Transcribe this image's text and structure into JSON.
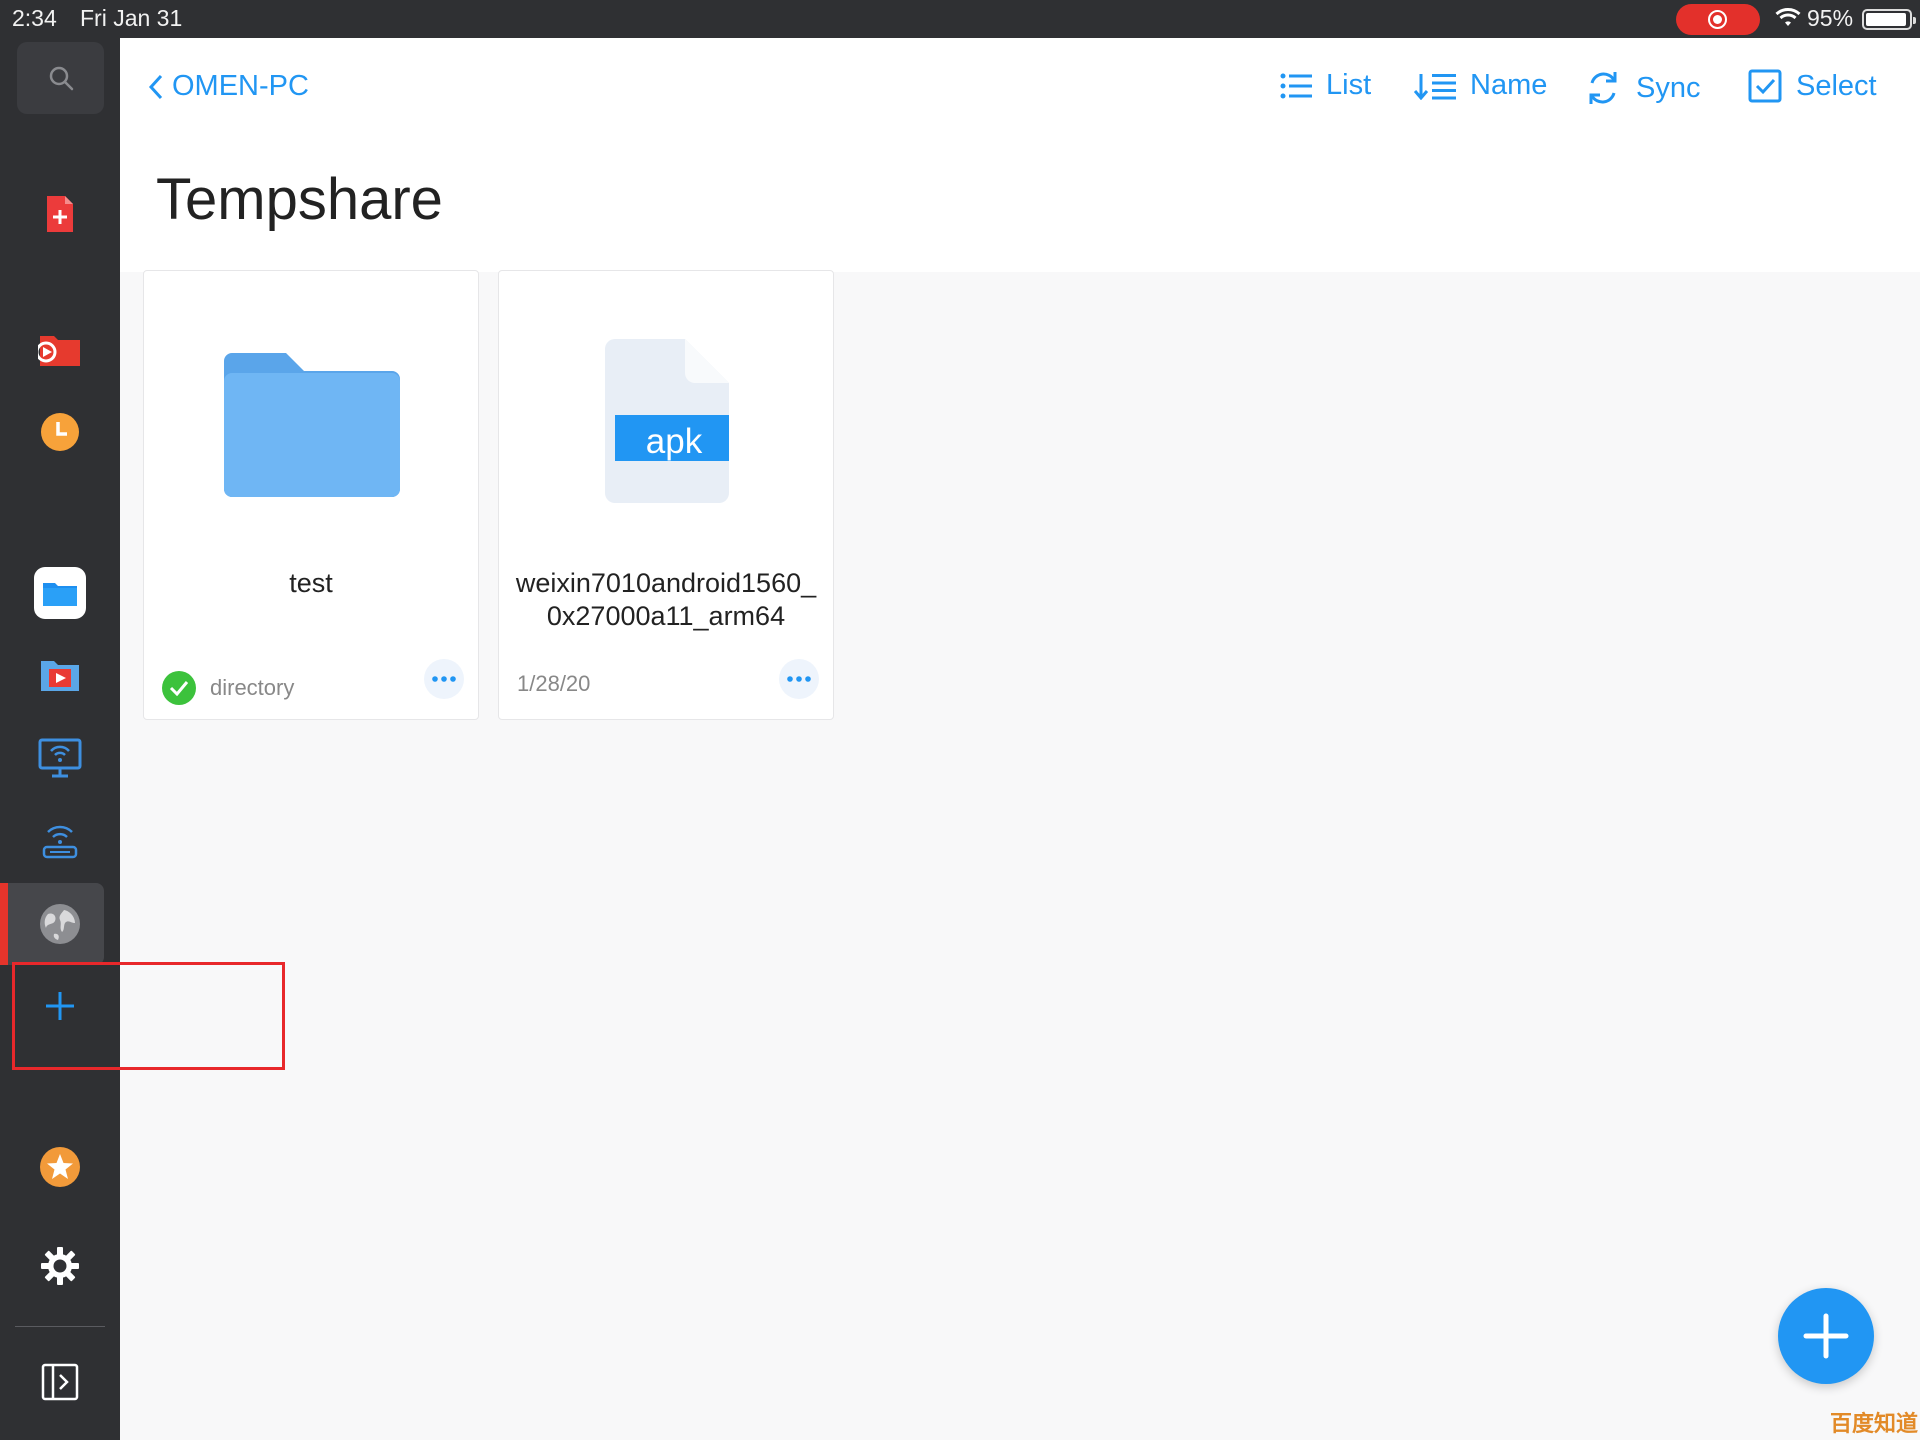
{
  "status_bar": {
    "time": "2:34",
    "date": "Fri Jan 31",
    "battery": "95%",
    "battery_level": 0.95
  },
  "nav": {
    "back_label": "OMEN-PC"
  },
  "toolbar": {
    "list_label": "List",
    "sort_label": "Name",
    "sync_label": "Sync",
    "select_label": "Select"
  },
  "page": {
    "title": "Tempshare"
  },
  "items": [
    {
      "name": "test",
      "meta": "directory",
      "type": "folder",
      "synced": true
    },
    {
      "name": "weixin7010android1560_0x27000a11_arm64",
      "meta": "1/28/20",
      "type": "file",
      "ext": "apk"
    }
  ],
  "sidebar": {
    "items": [
      {
        "icon": "search-icon"
      },
      {
        "icon": "pdf-add-icon"
      },
      {
        "icon": "video-icon"
      },
      {
        "icon": "recent-clock-icon"
      },
      {
        "icon": "files-icon"
      },
      {
        "icon": "media-folder-icon"
      },
      {
        "icon": "computer-wifi-icon"
      },
      {
        "icon": "router-icon"
      },
      {
        "icon": "globe-icon",
        "active": true
      },
      {
        "icon": "add-icon"
      },
      {
        "icon": "favorites-star-icon"
      },
      {
        "icon": "settings-gear-icon"
      },
      {
        "icon": "collapse-sidebar-icon"
      }
    ]
  },
  "watermark": "百度知道",
  "colors": {
    "accent": "#2196f3",
    "sidebar": "#2f3033",
    "highlight": "#e8282b",
    "success": "#3cc23c"
  }
}
